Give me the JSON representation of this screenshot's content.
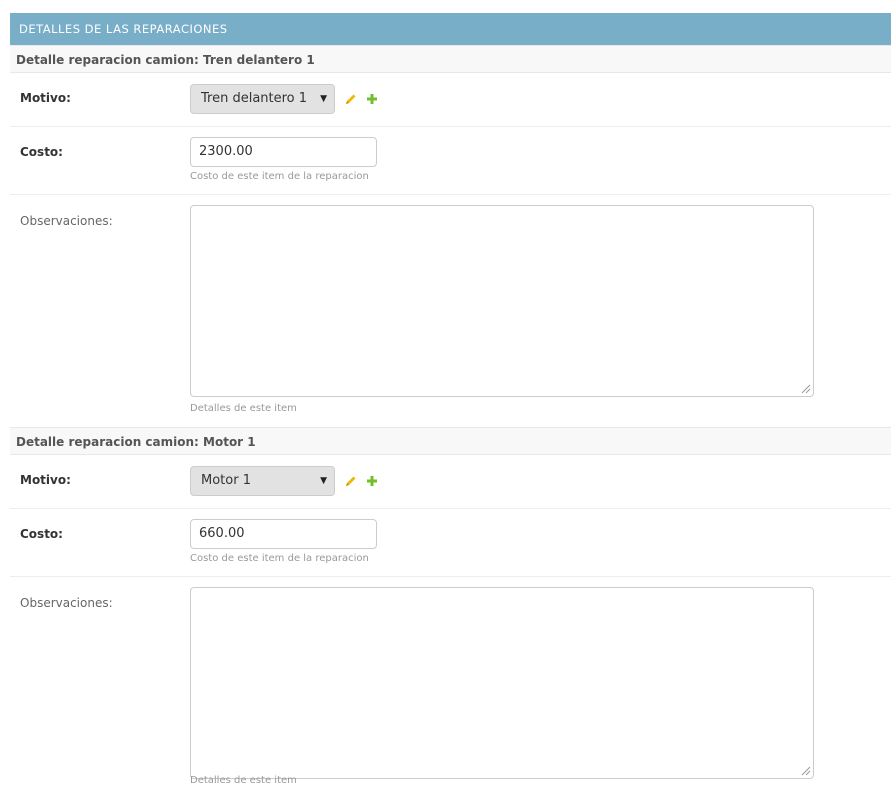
{
  "module": {
    "title": "DETALLES DE LAS REPARACIONES"
  },
  "inlines": [
    {
      "header": "Detalle reparacion camion: Tren delantero 1",
      "motivo_label": "Motivo:",
      "motivo_value": "Tren delantero 1",
      "costo_label": "Costo:",
      "costo_value": "2300.00",
      "costo_help": "Costo de este item de la reparacion",
      "obs_label": "Observaciones:",
      "obs_value": "",
      "obs_help": "Detalles de este item"
    },
    {
      "header": "Detalle reparacion camion: Motor 1",
      "motivo_label": "Motivo:",
      "motivo_value": "Motor 1",
      "costo_label": "Costo:",
      "costo_value": "660.00",
      "costo_help": "Costo de este item de la reparacion",
      "obs_label": "Observaciones:",
      "obs_value": "",
      "obs_help": "Detalles de este item"
    }
  ],
  "icons": {
    "caret": "caret-down-icon",
    "edit": "pencil-icon",
    "add": "plus-icon"
  },
  "colors": {
    "header_bg": "#79aec8",
    "edit_icon": "#efb80b",
    "add_icon": "#70bf2b"
  }
}
